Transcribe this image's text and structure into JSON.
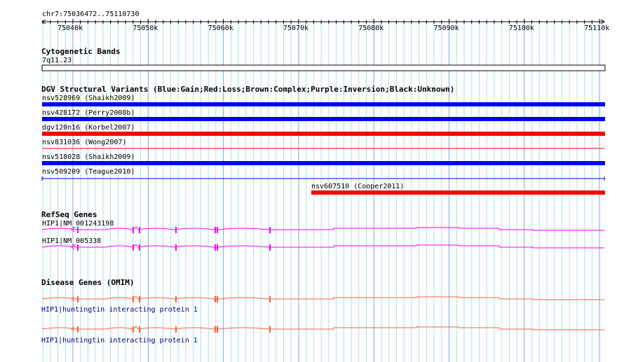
{
  "ruler": {
    "label": "chr7:75036472..75110730",
    "start": 75036472,
    "end": 75110730,
    "ticks": [
      "75040k",
      "75050k",
      "75060k",
      "75070k",
      "75080k",
      "75090k",
      "75100k",
      "75110k"
    ]
  },
  "cytoband": {
    "title": "Cytogenetic Bands",
    "band": "7q11.23"
  },
  "dgv": {
    "title": "DGV Structural Variants (Blue:Gain;Red:Loss;Brown:Complex;Purple:Inversion;Black:Unknown)",
    "items": [
      {
        "label": "nsv528969 (Shaikh2009)",
        "color": "#0000ff",
        "style": "thick"
      },
      {
        "label": "nsv428172 (Perry2008b)",
        "color": "#0000ff",
        "style": "thick"
      },
      {
        "label": "dgv120n16 (Korbel2007)",
        "color": "#ff0000",
        "style": "thick"
      },
      {
        "label": "nsv831036 (Wong2007)",
        "color": "#ff0000",
        "style": "thin"
      },
      {
        "label": "nsv518028 (Shaikh2009)",
        "color": "#0000ff",
        "style": "thick"
      },
      {
        "label": "nsv509209 (Teague2010)",
        "color": "#0000ff",
        "style": "line"
      },
      {
        "label": "nsv607510 (Cooper2011)",
        "color": "#ff0000",
        "style": "thick"
      }
    ]
  },
  "refseq": {
    "title": "RefSeq Genes",
    "color": "#ff00ff",
    "items": [
      {
        "label": "HIP1|NM_001243198"
      },
      {
        "label": "HIP1|NM_005338"
      }
    ]
  },
  "omim": {
    "title": "Disease Genes (OMIM)",
    "color": "#ff6040",
    "items": [
      {
        "label": "HIP1|huntingtin interacting protein 1"
      },
      {
        "label": "HIP1|huntingtin interacting protein 1"
      }
    ]
  }
}
